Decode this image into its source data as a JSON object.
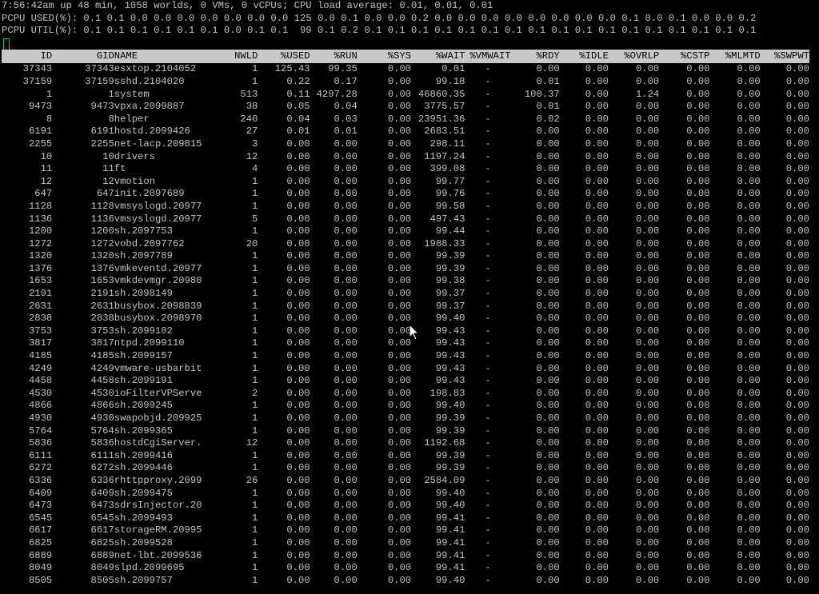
{
  "status": {
    "line1": "7:56:42am up 48 min, 1058 worlds, 0 VMs, 0 vCPUs; CPU load average: 0.01, 0.01, 0.01",
    "line2": "PCPU USED(%): 0.1 0.1 0.0 0.0 0.0 0.0 0.0 0.0 0.0 125 0.0 0.1 0.0 0.0 0.2 0.0 0.0 0.0 0.0 0.0 0.0 0.0 0.0 0.1 0.0 0.1 0.0 0.0 0.2",
    "line3": "PCPU UTIL(%): 0.1 0.1 0.1 0.1 0.1 0.1 0.0 0.1 0.1  99 0.1 0.2 0.1 0.1 0.1 0.1 0.1 0.1 0.1 0.1 0.1 0.1 0.1 0.1 0.1 0.1 0.1 0.1 0.1"
  },
  "columns": [
    "ID",
    "GID",
    "NAME",
    "NWLD",
    "%USED",
    "%RUN",
    "%SYS",
    "%WAIT",
    "%VMWAIT",
    "%RDY",
    "%IDLE",
    "%OVRLP",
    "%CSTP",
    "%MLMTD",
    "%SWPWT"
  ],
  "rows": [
    [
      "37343",
      "37343",
      "esxtop.2104052",
      "1",
      "125.43",
      "99.35",
      "0.00",
      "0.01",
      "-",
      "0.00",
      "0.00",
      "0.00",
      "0.00",
      "0.00",
      "0.00"
    ],
    [
      "37159",
      "37159",
      "sshd.2104020",
      "1",
      "0.22",
      "0.17",
      "0.00",
      "99.18",
      "-",
      "0.01",
      "0.00",
      "0.00",
      "0.00",
      "0.00",
      "0.00"
    ],
    [
      "1",
      "1",
      "system",
      "513",
      "0.11",
      "4297.28",
      "0.00",
      "46860.35",
      "-",
      "100.37",
      "0.00",
      "1.24",
      "0.00",
      "0.00",
      "0.00"
    ],
    [
      "9473",
      "9473",
      "vpxa.2099887",
      "38",
      "0.05",
      "0.04",
      "0.00",
      "3775.57",
      "-",
      "0.01",
      "0.00",
      "0.00",
      "0.00",
      "0.00",
      "0.00"
    ],
    [
      "8",
      "8",
      "helper",
      "240",
      "0.04",
      "0.03",
      "0.00",
      "23951.36",
      "-",
      "0.02",
      "0.00",
      "0.00",
      "0.00",
      "0.00",
      "0.00"
    ],
    [
      "6191",
      "6191",
      "hostd.2099426",
      "27",
      "0.01",
      "0.01",
      "0.00",
      "2683.51",
      "-",
      "0.00",
      "0.00",
      "0.00",
      "0.00",
      "0.00",
      "0.00"
    ],
    [
      "2255",
      "2255",
      "net-lacp.209815",
      "3",
      "0.00",
      "0.00",
      "0.00",
      "298.11",
      "-",
      "0.00",
      "0.00",
      "0.00",
      "0.00",
      "0.00",
      "0.00"
    ],
    [
      "10",
      "10",
      "drivers",
      "12",
      "0.00",
      "0.00",
      "0.00",
      "1197.24",
      "-",
      "0.00",
      "0.00",
      "0.00",
      "0.00",
      "0.00",
      "0.00"
    ],
    [
      "11",
      "11",
      "ft",
      "4",
      "0.00",
      "0.00",
      "0.00",
      "399.08",
      "-",
      "0.00",
      "0.00",
      "0.00",
      "0.00",
      "0.00",
      "0.00"
    ],
    [
      "12",
      "12",
      "vmotion",
      "1",
      "0.00",
      "0.00",
      "0.00",
      "99.77",
      "-",
      "0.00",
      "0.00",
      "0.00",
      "0.00",
      "0.00",
      "0.00"
    ],
    [
      "647",
      "647",
      "init.2097689",
      "1",
      "0.00",
      "0.00",
      "0.00",
      "99.76",
      "-",
      "0.00",
      "0.00",
      "0.00",
      "0.00",
      "0.00",
      "0.00"
    ],
    [
      "1128",
      "1128",
      "vmsyslogd.20977",
      "1",
      "0.00",
      "0.00",
      "0.00",
      "99.58",
      "-",
      "0.00",
      "0.00",
      "0.00",
      "0.00",
      "0.00",
      "0.00"
    ],
    [
      "1136",
      "1136",
      "vmsyslogd.20977",
      "5",
      "0.00",
      "0.00",
      "0.00",
      "497.43",
      "-",
      "0.00",
      "0.00",
      "0.00",
      "0.00",
      "0.00",
      "0.00"
    ],
    [
      "1200",
      "1200",
      "sh.2097753",
      "1",
      "0.00",
      "0.00",
      "0.00",
      "99.44",
      "-",
      "0.00",
      "0.00",
      "0.00",
      "0.00",
      "0.00",
      "0.00"
    ],
    [
      "1272",
      "1272",
      "vobd.2097762",
      "20",
      "0.00",
      "0.00",
      "0.00",
      "1988.33",
      "-",
      "0.00",
      "0.00",
      "0.00",
      "0.00",
      "0.00",
      "0.00"
    ],
    [
      "1320",
      "1320",
      "sh.2097789",
      "1",
      "0.00",
      "0.00",
      "0.00",
      "99.39",
      "-",
      "0.00",
      "0.00",
      "0.00",
      "0.00",
      "0.00",
      "0.00"
    ],
    [
      "1376",
      "1376",
      "vmkeventd.20977",
      "1",
      "0.00",
      "0.00",
      "0.00",
      "99.39",
      "-",
      "0.00",
      "0.00",
      "0.00",
      "0.00",
      "0.00",
      "0.00"
    ],
    [
      "1653",
      "1653",
      "vmkdevmgr.20980",
      "1",
      "0.00",
      "0.00",
      "0.00",
      "99.38",
      "-",
      "0.00",
      "0.00",
      "0.00",
      "0.00",
      "0.00",
      "0.00"
    ],
    [
      "2191",
      "2191",
      "sh.2098149",
      "1",
      "0.00",
      "0.00",
      "0.00",
      "99.37",
      "-",
      "0.00",
      "0.00",
      "0.00",
      "0.00",
      "0.00",
      "0.00"
    ],
    [
      "2631",
      "2631",
      "busybox.2098839",
      "1",
      "0.00",
      "0.00",
      "0.00",
      "99.37",
      "-",
      "0.00",
      "0.00",
      "0.00",
      "0.00",
      "0.00",
      "0.00"
    ],
    [
      "2838",
      "2838",
      "busybox.2098970",
      "1",
      "0.00",
      "0.00",
      "0.00",
      "99.40",
      "-",
      "0.00",
      "0.00",
      "0.00",
      "0.00",
      "0.00",
      "0.00"
    ],
    [
      "3753",
      "3753",
      "sh.2099102",
      "1",
      "0.00",
      "0.00",
      "0.00",
      "99.43",
      "-",
      "0.00",
      "0.00",
      "0.00",
      "0.00",
      "0.00",
      "0.00"
    ],
    [
      "3817",
      "3817",
      "ntpd.2099110",
      "1",
      "0.00",
      "0.00",
      "0.00",
      "99.43",
      "-",
      "0.00",
      "0.00",
      "0.00",
      "0.00",
      "0.00",
      "0.00"
    ],
    [
      "4185",
      "4185",
      "sh.2099157",
      "1",
      "0.00",
      "0.00",
      "0.00",
      "99.43",
      "-",
      "0.00",
      "0.00",
      "0.00",
      "0.00",
      "0.00",
      "0.00"
    ],
    [
      "4249",
      "4249",
      "vmware-usbarbit",
      "1",
      "0.00",
      "0.00",
      "0.00",
      "99.43",
      "-",
      "0.00",
      "0.00",
      "0.00",
      "0.00",
      "0.00",
      "0.00"
    ],
    [
      "4458",
      "4458",
      "sh.2099191",
      "1",
      "0.00",
      "0.00",
      "0.00",
      "99.43",
      "-",
      "0.00",
      "0.00",
      "0.00",
      "0.00",
      "0.00",
      "0.00"
    ],
    [
      "4530",
      "4530",
      "ioFilterVPServe",
      "2",
      "0.00",
      "0.00",
      "0.00",
      "198.83",
      "-",
      "0.00",
      "0.00",
      "0.00",
      "0.00",
      "0.00",
      "0.00"
    ],
    [
      "4866",
      "4866",
      "sh.2099245",
      "1",
      "0.00",
      "0.00",
      "0.00",
      "99.40",
      "-",
      "0.00",
      "0.00",
      "0.00",
      "0.00",
      "0.00",
      "0.00"
    ],
    [
      "4930",
      "4930",
      "swapobjd.209925",
      "1",
      "0.00",
      "0.00",
      "0.00",
      "99.39",
      "-",
      "0.00",
      "0.00",
      "0.00",
      "0.00",
      "0.00",
      "0.00"
    ],
    [
      "5764",
      "5764",
      "sh.2099365",
      "1",
      "0.00",
      "0.00",
      "0.00",
      "99.39",
      "-",
      "0.00",
      "0.00",
      "0.00",
      "0.00",
      "0.00",
      "0.00"
    ],
    [
      "5836",
      "5836",
      "hostdCgiServer.",
      "12",
      "0.00",
      "0.00",
      "0.00",
      "1192.68",
      "-",
      "0.00",
      "0.00",
      "0.00",
      "0.00",
      "0.00",
      "0.00"
    ],
    [
      "6111",
      "6111",
      "sh.2099416",
      "1",
      "0.00",
      "0.00",
      "0.00",
      "99.39",
      "-",
      "0.00",
      "0.00",
      "0.00",
      "0.00",
      "0.00",
      "0.00"
    ],
    [
      "6272",
      "6272",
      "sh.2099446",
      "1",
      "0.00",
      "0.00",
      "0.00",
      "99.39",
      "-",
      "0.00",
      "0.00",
      "0.00",
      "0.00",
      "0.00",
      "0.00"
    ],
    [
      "6336",
      "6336",
      "rhttpproxy.2099",
      "26",
      "0.00",
      "0.00",
      "0.00",
      "2584.09",
      "-",
      "0.00",
      "0.00",
      "0.00",
      "0.00",
      "0.00",
      "0.00"
    ],
    [
      "6409",
      "6409",
      "sh.2099475",
      "1",
      "0.00",
      "0.00",
      "0.00",
      "99.40",
      "-",
      "0.00",
      "0.00",
      "0.00",
      "0.00",
      "0.00",
      "0.00"
    ],
    [
      "6473",
      "6473",
      "sdrsInjector.20",
      "1",
      "0.00",
      "0.00",
      "0.00",
      "99.40",
      "-",
      "0.00",
      "0.00",
      "0.00",
      "0.00",
      "0.00",
      "0.00"
    ],
    [
      "6545",
      "6545",
      "sh.2099493",
      "1",
      "0.00",
      "0.00",
      "0.00",
      "99.41",
      "-",
      "0.00",
      "0.00",
      "0.00",
      "0.00",
      "0.00",
      "0.00"
    ],
    [
      "6617",
      "6617",
      "storageRM.20995",
      "1",
      "0.00",
      "0.00",
      "0.00",
      "99.41",
      "-",
      "0.00",
      "0.00",
      "0.00",
      "0.00",
      "0.00",
      "0.00"
    ],
    [
      "6825",
      "6825",
      "sh.2099528",
      "1",
      "0.00",
      "0.00",
      "0.00",
      "99.41",
      "-",
      "0.00",
      "0.00",
      "0.00",
      "0.00",
      "0.00",
      "0.00"
    ],
    [
      "6889",
      "6889",
      "net-lbt.2099536",
      "1",
      "0.00",
      "0.00",
      "0.00",
      "99.41",
      "-",
      "0.00",
      "0.00",
      "0.00",
      "0.00",
      "0.00",
      "0.00"
    ],
    [
      "8049",
      "8049",
      "slpd.2099695",
      "1",
      "0.00",
      "0.00",
      "0.00",
      "99.41",
      "-",
      "0.00",
      "0.00",
      "0.00",
      "0.00",
      "0.00",
      "0.00"
    ],
    [
      "8505",
      "8505",
      "sh.2099757",
      "1",
      "0.00",
      "0.00",
      "0.00",
      "99.40",
      "-",
      "0.00",
      "0.00",
      "0.00",
      "0.00",
      "0.00",
      "0.00"
    ]
  ],
  "colors": {
    "background": "#000000",
    "text": "#c4c4c4",
    "header_bg": "#c8c8c8",
    "cursor": "#22c55e"
  },
  "icons": {
    "mouse": "mouse-pointer-icon",
    "cursor": "text-cursor-icon"
  }
}
